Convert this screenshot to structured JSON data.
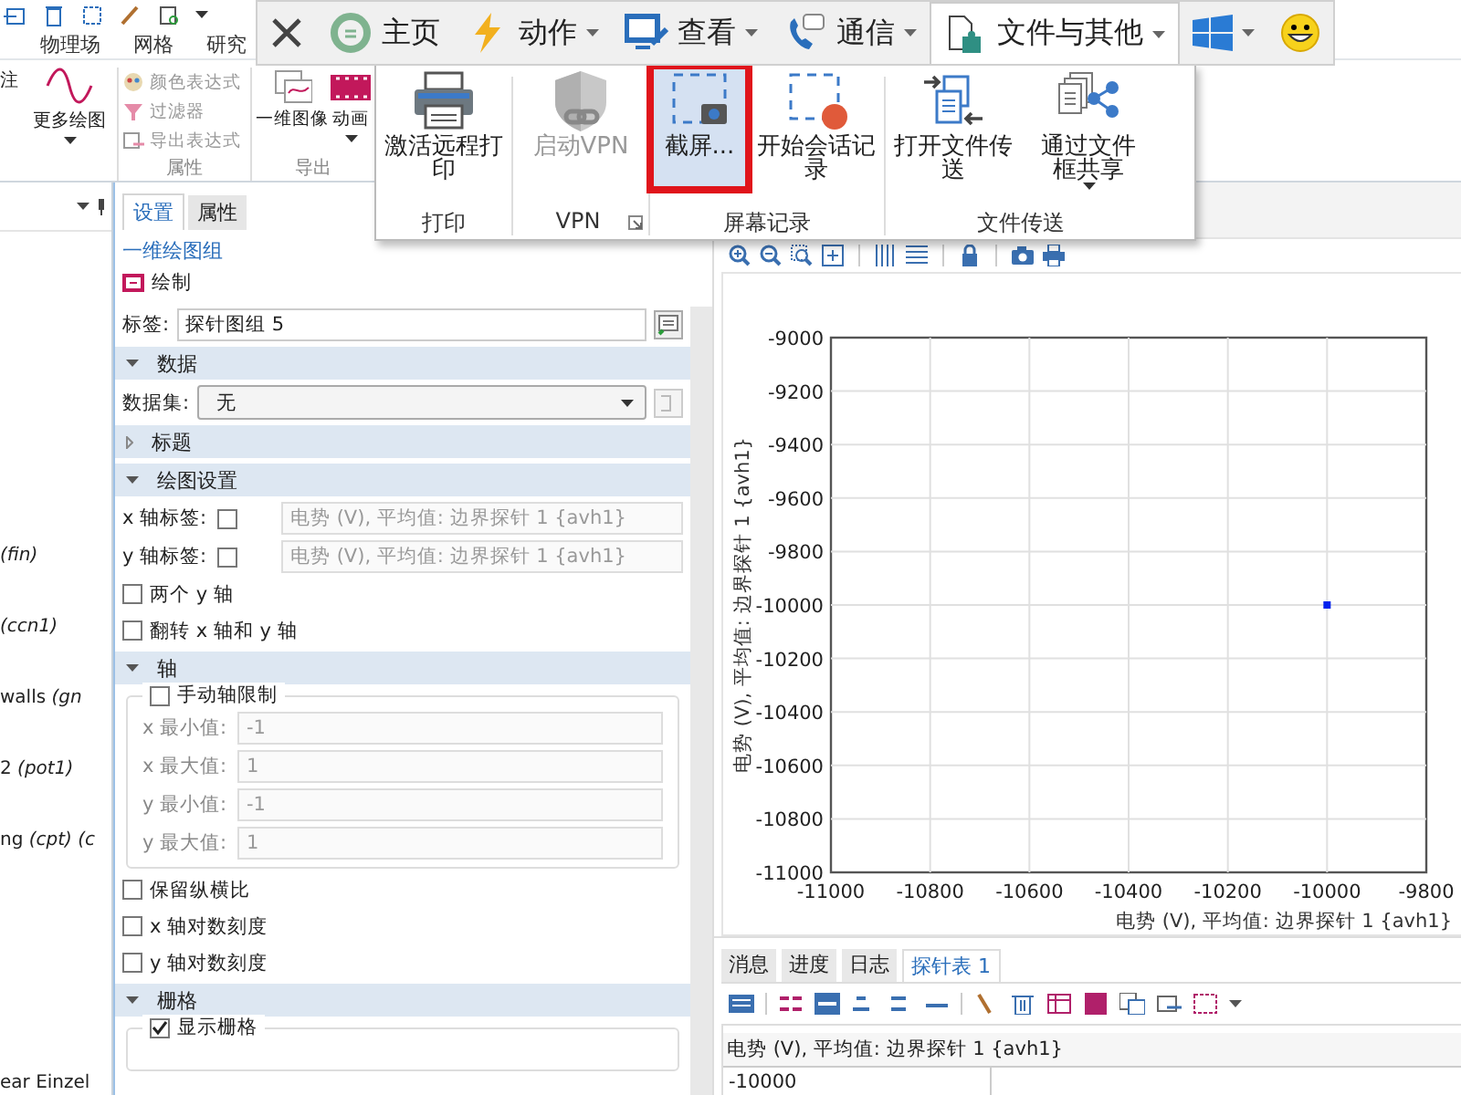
{
  "ribbon": {
    "tabs": [
      {
        "label": "物理场",
        "selected": false
      },
      {
        "label": "网格",
        "selected": false
      },
      {
        "label": "研究",
        "selected": false
      }
    ],
    "partial_label": "注",
    "plot_button": {
      "label": "更多绘图",
      "has_menu": true
    },
    "attribute_group": {
      "label": "属性",
      "items": [
        {
          "label": "颜色表达式",
          "disabled": true
        },
        {
          "label": "过滤器",
          "disabled": true
        },
        {
          "label": "导出表达式",
          "disabled": true
        }
      ]
    },
    "export_group": {
      "label": "导出",
      "items": [
        {
          "label": "一维图像",
          "has_menu": false
        },
        {
          "label": "动画",
          "has_menu": true
        }
      ]
    }
  },
  "remote_toolbar": {
    "items": [
      {
        "label": "主页",
        "has_menu": false,
        "selected": false
      },
      {
        "label": "动作",
        "has_menu": true,
        "selected": false
      },
      {
        "label": "查看",
        "has_menu": true,
        "selected": false
      },
      {
        "label": "通信",
        "has_menu": true,
        "selected": false
      },
      {
        "label": "文件与其他",
        "has_menu": true,
        "selected": true
      }
    ]
  },
  "remote_menu": {
    "groups": [
      {
        "label": "打印",
        "launcher": false,
        "items": [
          {
            "label": "激活远程打印",
            "disabled": false,
            "selected": false,
            "has_menu": false
          }
        ]
      },
      {
        "label": "VPN",
        "launcher": true,
        "items": [
          {
            "label": "启动VPN",
            "disabled": true,
            "selected": false,
            "has_menu": false
          }
        ]
      },
      {
        "label": "屏幕记录",
        "launcher": false,
        "items": [
          {
            "label": "截屏...",
            "disabled": false,
            "selected": true,
            "has_menu": false
          },
          {
            "label": "开始会话记录",
            "disabled": false,
            "selected": false,
            "has_menu": false
          }
        ]
      },
      {
        "label": "文件传送",
        "launcher": false,
        "items": [
          {
            "label": "打开文件传送",
            "disabled": false,
            "selected": false,
            "has_menu": false
          },
          {
            "label": "通过文件框共享",
            "disabled": false,
            "selected": false,
            "has_menu": true
          }
        ]
      }
    ]
  },
  "model_tree": {
    "items": [
      {
        "text": "*(fin)*"
      },
      {
        "text": "*(ccn1)*"
      },
      {
        "text": "walls *(gn*"
      },
      {
        "text": "2 *(pot1)*"
      },
      {
        "text": "ng *(cpt) (c*"
      },
      {
        "text": "ear Einzel"
      }
    ]
  },
  "settings": {
    "tabs": [
      {
        "label": "设置",
        "selected": true
      },
      {
        "label": "属性",
        "selected": false
      }
    ],
    "title": "一维绘图组",
    "plot_button": "绘制",
    "label_field": {
      "label": "标签:",
      "value": "探针图组 5"
    },
    "sections": [
      {
        "title": "数据",
        "expanded": true,
        "rows": [
          {
            "kind": "select",
            "label": "数据集:",
            "value": "无"
          }
        ]
      },
      {
        "title": "标题",
        "expanded": false
      },
      {
        "title": "绘图设置",
        "expanded": true,
        "rows": [
          {
            "kind": "check_field",
            "label": "x 轴标签:",
            "checked": false,
            "value": "电势 (V), 平均值: 边界探针 1 {avh1}"
          },
          {
            "kind": "check_field",
            "label": "y 轴标签:",
            "checked": false,
            "value": "电势 (V), 平均值: 边界探针 1 {avh1}"
          },
          {
            "kind": "checkbox",
            "label": "两个 y 轴",
            "checked": false
          },
          {
            "kind": "checkbox",
            "label": "翻转 x 轴和 y 轴",
            "checked": false
          }
        ]
      },
      {
        "title": "轴",
        "expanded": true,
        "rows": [
          {
            "kind": "fieldset",
            "label": "手动轴限制",
            "checked": false,
            "fields": [
              {
                "label": "x 最小值:",
                "value": "-1"
              },
              {
                "label": "x 最大值:",
                "value": "1"
              },
              {
                "label": "y 最小值:",
                "value": "-1"
              },
              {
                "label": "y 最大值:",
                "value": "1"
              }
            ]
          },
          {
            "kind": "checkbox",
            "label": "保留纵横比",
            "checked": false
          },
          {
            "kind": "checkbox",
            "label": "x 轴对数刻度",
            "checked": false
          },
          {
            "kind": "checkbox",
            "label": "y 轴对数刻度",
            "checked": false
          }
        ]
      },
      {
        "title": "栅格",
        "expanded": true,
        "rows": [
          {
            "kind": "fieldset",
            "label": "显示栅格",
            "checked": true
          }
        ]
      }
    ]
  },
  "plot": {
    "chart_data": {
      "type": "scatter",
      "xlabel": "电势 (V), 平均值: 边界探针 1 {avh1}",
      "ylabel": "电势 (V), 平均值: 边界探针 1 {avh1}",
      "x": [
        -10000
      ],
      "series": [
        {
          "color": "#0022ee",
          "values": [
            -10000
          ]
        }
      ],
      "grid": true,
      "xlim": [
        -11000,
        -9800
      ],
      "ylim": [
        -11000,
        -9000
      ],
      "xticks": [
        -11000,
        -10800,
        -10600,
        -10400,
        -10200,
        -10000,
        -9800
      ],
      "yticks": [
        -11000,
        -10800,
        -10600,
        -10400,
        -10200,
        -10000,
        -9800,
        -9600,
        -9400,
        -9200,
        -9000
      ]
    }
  },
  "results": {
    "tabs": [
      {
        "label": "消息",
        "selected": false
      },
      {
        "label": "进度",
        "selected": false
      },
      {
        "label": "日志",
        "selected": false
      },
      {
        "label": "探针表 1",
        "selected": true
      }
    ],
    "table": {
      "columns": [
        "电势 (V), 平均值: 边界探针 1 {avh1}"
      ],
      "rows": [
        [
          "-10000"
        ]
      ]
    }
  }
}
